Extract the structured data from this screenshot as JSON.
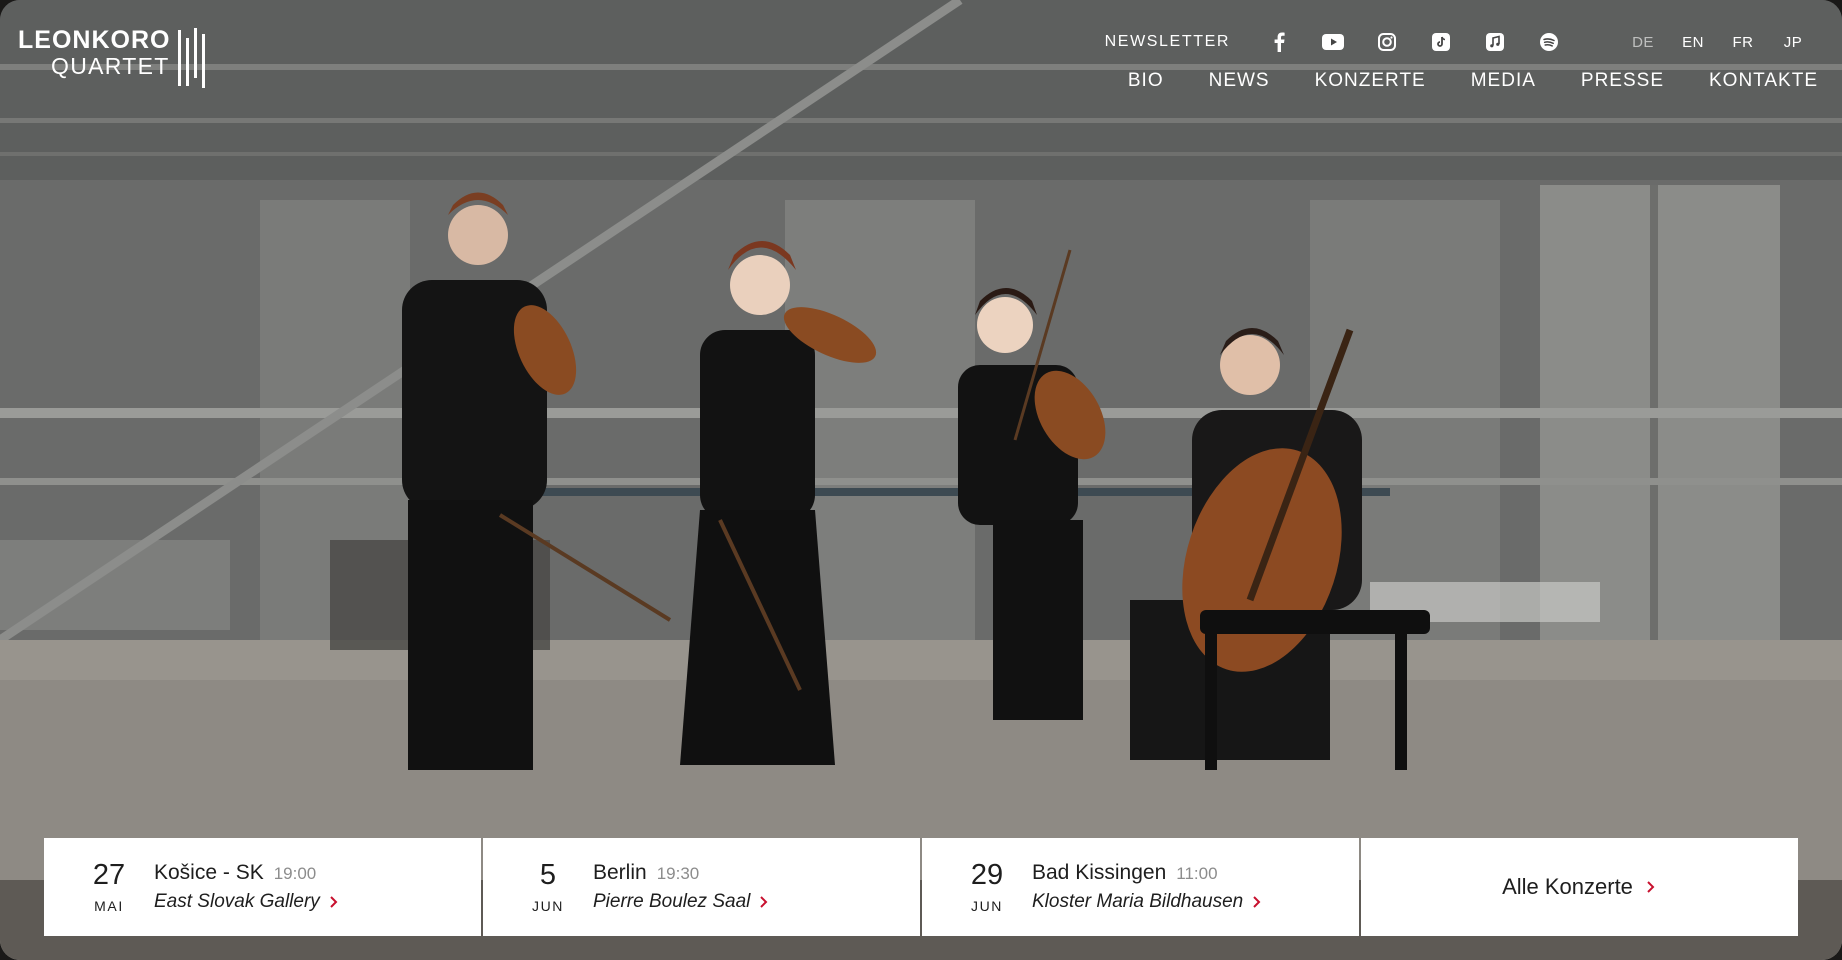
{
  "brand": {
    "line1": "LEONKORO",
    "line2": "QUARTET"
  },
  "topbar": {
    "newsletter": "NEWSLETTER",
    "social": [
      "facebook-icon",
      "youtube-icon",
      "instagram-icon",
      "tiktok-icon",
      "apple-music-icon",
      "spotify-icon"
    ],
    "languages": [
      "DE",
      "EN",
      "FR",
      "JP"
    ],
    "active_language": "DE"
  },
  "nav": {
    "items": [
      "BIO",
      "NEWS",
      "KONZERTE",
      "MEDIA",
      "PRESSE",
      "KONTAKTE"
    ]
  },
  "concerts": [
    {
      "day": "27",
      "month": "MAI",
      "city": "Košice - SK",
      "time": "19:00",
      "venue": "East Slovak Gallery"
    },
    {
      "day": "5",
      "month": "JUN",
      "city": "Berlin",
      "time": "19:30",
      "venue": "Pierre Boulez Saal"
    },
    {
      "day": "29",
      "month": "JUN",
      "city": "Bad Kissingen",
      "time": "11:00",
      "venue": "Kloster Maria Bildhausen"
    }
  ],
  "all_concerts_label": "Alle Konzerte",
  "colors": {
    "accent": "#c8102e",
    "text": "#1e1e1e",
    "muted": "#8c8c8c",
    "white": "#ffffff"
  }
}
